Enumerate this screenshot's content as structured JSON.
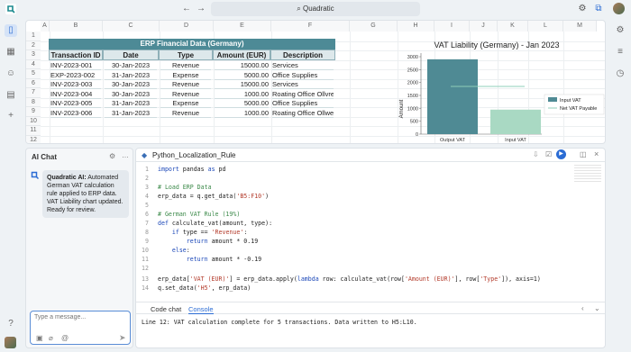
{
  "app": {
    "search_label": "Quadratic"
  },
  "grid": {
    "columns": [
      "A",
      "B",
      "C",
      "D",
      "E",
      "F",
      "G",
      "H",
      "I",
      "J",
      "K",
      "L",
      "M"
    ],
    "rows": [
      "1",
      "2",
      "3",
      "4",
      "5",
      "6",
      "7",
      "8",
      "9",
      "10",
      "11",
      "12"
    ]
  },
  "erp": {
    "title": "ERP Financial Data (Germany)",
    "headers": [
      "Transaction ID",
      "Date",
      "Type",
      "Amount (EUR)",
      "Description"
    ],
    "rows": [
      [
        "INV-2023-001",
        "30-Jan-2023",
        "Revenue",
        "15000.00",
        "Services"
      ],
      [
        "EXP-2023-002",
        "31-Jan-2023",
        "Expense",
        "5000.00",
        "Office Supplies"
      ],
      [
        "INV-2023-003",
        "30-Jan-2023",
        "Revenue",
        "15000.00",
        "Services"
      ],
      [
        "INV-2023-004",
        "30-Jan-2023",
        "Revenue",
        "1000.00",
        "Roating Office Ollvre"
      ],
      [
        "INV-2023-005",
        "31-Jan-2023",
        "Expense",
        "5000.00",
        "Office Supplies"
      ],
      [
        "INV-2023-006",
        "31-Jan-2023",
        "Revenue",
        "1000.00",
        "Roating Office Ollwe"
      ]
    ]
  },
  "chart_data": {
    "type": "bar",
    "title": "VAT Liability (Germany) - Jan 2023",
    "categories": [
      "Output VAT",
      "Input VAT"
    ],
    "series": [
      {
        "name": "Input VAT",
        "values": [
          2900,
          950
        ]
      },
      {
        "name": "Net VAT Payable",
        "type": "line",
        "values": [
          1850,
          1850
        ]
      }
    ],
    "bar_colors": [
      "#4f8a94",
      "#a9d9c3"
    ],
    "line_color": "#8fcfb9",
    "xlabel": "",
    "ylabel": "Amount",
    "ylim": [
      0,
      3000
    ],
    "yticks": [
      "0",
      "500",
      "1000",
      "1500",
      "2000",
      "2500",
      "3000"
    ],
    "legend": "right"
  },
  "ai_chat": {
    "title": "AI Chat",
    "message": "Quadratic AI: Automated German VAT calculation rule applied to ERP data. VAT Liability chart updated. Ready for review.",
    "message_sender": "Quadratic AI:",
    "message_body": "Automated German VAT calculation rule applied to ERP data. VAT Liability chart updated. Ready for review.",
    "input_placeholder": "Type a message..."
  },
  "code": {
    "tab_title": "Python_Localization_Rule",
    "bottom_tabs": [
      "Code chat",
      "Console"
    ],
    "active_bottom_tab": "Console",
    "console_output": "Line 12: VAT calculation complete for 5 transactions. Data written to H5:L10.",
    "lines": [
      {
        "n": "1",
        "segments": [
          {
            "c": "kw",
            "t": "import"
          },
          {
            "c": "",
            "t": " pandas "
          },
          {
            "c": "kw",
            "t": "as"
          },
          {
            "c": "",
            "t": " pd"
          }
        ]
      },
      {
        "n": "2",
        "segments": []
      },
      {
        "n": "3",
        "segments": [
          {
            "c": "cm",
            "t": "# Load ERP Data"
          }
        ]
      },
      {
        "n": "4",
        "segments": [
          {
            "c": "",
            "t": "erp_data = q.get_data("
          },
          {
            "c": "st",
            "t": "'B5:F10'"
          },
          {
            "c": "",
            "t": ")"
          }
        ]
      },
      {
        "n": "5",
        "segments": []
      },
      {
        "n": "6",
        "segments": [
          {
            "c": "cm",
            "t": "# German VAT Rule (19%)"
          }
        ]
      },
      {
        "n": "7",
        "segments": [
          {
            "c": "kw",
            "t": "def"
          },
          {
            "c": "",
            "t": " calculate_vat(amount, type):"
          }
        ]
      },
      {
        "n": "8",
        "segments": [
          {
            "c": "",
            "t": "    "
          },
          {
            "c": "kw",
            "t": "if"
          },
          {
            "c": "",
            "t": " type == "
          },
          {
            "c": "st",
            "t": "'Revenue'"
          },
          {
            "c": "",
            "t": ":"
          }
        ]
      },
      {
        "n": "9",
        "segments": [
          {
            "c": "",
            "t": "        "
          },
          {
            "c": "kw",
            "t": "return"
          },
          {
            "c": "",
            "t": " amount * 0.19"
          }
        ]
      },
      {
        "n": "10",
        "segments": [
          {
            "c": "",
            "t": "    "
          },
          {
            "c": "kw",
            "t": "else"
          },
          {
            "c": "",
            "t": ":"
          }
        ]
      },
      {
        "n": "11",
        "segments": [
          {
            "c": "",
            "t": "        "
          },
          {
            "c": "kw",
            "t": "return"
          },
          {
            "c": "",
            "t": " amount * -0.19"
          }
        ]
      },
      {
        "n": "12",
        "segments": []
      },
      {
        "n": "13",
        "segments": [
          {
            "c": "",
            "t": "erp_data["
          },
          {
            "c": "st",
            "t": "'VAT (EUR)'"
          },
          {
            "c": "",
            "t": "] = erp_data.apply("
          },
          {
            "c": "kw",
            "t": "lambda"
          },
          {
            "c": "",
            "t": " row: calculate_vat(row["
          },
          {
            "c": "st",
            "t": "'Amount (EUR)'"
          },
          {
            "c": "",
            "t": "], row["
          },
          {
            "c": "st",
            "t": "'Type'"
          },
          {
            "c": "",
            "t": "]), axis=1)"
          }
        ]
      },
      {
        "n": "14",
        "segments": [
          {
            "c": "",
            "t": "q.set_data("
          },
          {
            "c": "st",
            "t": "'H5'"
          },
          {
            "c": "",
            "t": ", erp_data)"
          }
        ]
      }
    ]
  },
  "icons": {
    "logo": "quadratic-logo-icon",
    "left_rail": [
      "files-icon",
      "table-icon",
      "people-icon",
      "document-icon",
      "add-icon"
    ],
    "right_rail": [
      "settings-icon",
      "list-icon",
      "history-icon"
    ]
  },
  "colors": {
    "accent": "#2b6cd4",
    "table_header": "#4d8a96",
    "chart_output_bar": "#4f8a94",
    "chart_input_bar": "#a9d9c3"
  }
}
